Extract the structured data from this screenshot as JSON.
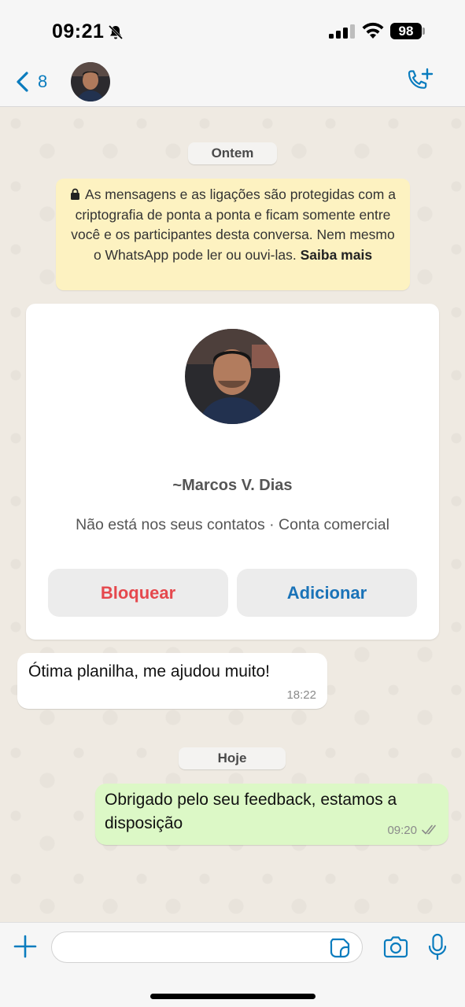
{
  "status_bar": {
    "time": "09:21",
    "battery": "98",
    "icons": [
      "bell-off-icon",
      "signal-icon",
      "wifi-icon",
      "battery-icon"
    ]
  },
  "header": {
    "back_count": "8",
    "icons": [
      "chevron-left-icon",
      "avatar",
      "phone-add-icon"
    ]
  },
  "chat": {
    "date_yesterday": "Ontem",
    "encryption_text": "As mensagens e as ligações são protegidas com a criptografia de ponta a ponta e ficam somente entre você e os participantes desta conversa. Nem mesmo o WhatsApp pode ler ou ouvi-las.",
    "encryption_link": "Saiba mais",
    "contact_card": {
      "name": "~Marcos V. Dias",
      "status": "Não está nos seus contatos · Conta comercial",
      "block_label": "Bloquear",
      "add_label": "Adicionar"
    },
    "messages": [
      {
        "direction": "incoming",
        "text": "Ótima planilha,  me ajudou muito!",
        "time": "18:22"
      },
      {
        "direction": "outgoing",
        "text": "Obrigado pelo seu feedback, estamos a disposição",
        "time": "09:20",
        "status": "read"
      }
    ],
    "date_today": "Hoje"
  },
  "input_bar": {
    "placeholder": "",
    "icons": [
      "plus-icon",
      "sticker-icon",
      "camera-icon",
      "microphone-icon"
    ]
  },
  "colors": {
    "accent": "#0a7cbe",
    "outgoing_bubble": "#dcf8c6",
    "notice_bg": "#fdf2c1",
    "block_red": "#e5484d",
    "add_blue": "#1a73b8"
  }
}
